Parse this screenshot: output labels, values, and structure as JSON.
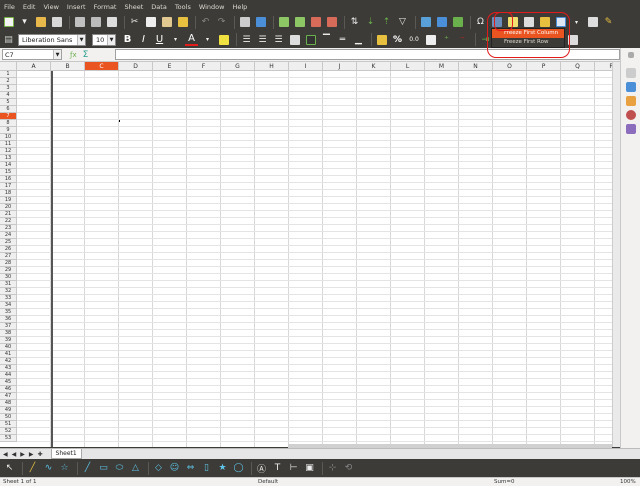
{
  "menu": [
    "File",
    "Edit",
    "View",
    "Insert",
    "Format",
    "Sheet",
    "Data",
    "Tools",
    "Window",
    "Help"
  ],
  "toolbar": {
    "font_name": "Liberation Sans",
    "font_size": "10",
    "bold_label": "B",
    "italic_label": "I",
    "underline_label": "U",
    "font_color_label": "A",
    "percent_label": "%",
    "number_label": "0.0"
  },
  "formula_bar": {
    "cell_ref": "C7",
    "sum_label": "Σ"
  },
  "columns": [
    "A",
    "B",
    "C",
    "D",
    "E",
    "F",
    "G",
    "H",
    "I",
    "J",
    "K",
    "L",
    "M",
    "N",
    "O",
    "P",
    "Q",
    "R"
  ],
  "active_column": "C",
  "row_count": 53,
  "active_row": 7,
  "freeze_menu": {
    "items": [
      "Freeze First Column",
      "Freeze First Row"
    ],
    "highlighted_index": 0
  },
  "sheet_tabs": [
    "Sheet1"
  ],
  "status": {
    "sheet_info": "Sheet 1 of 1",
    "page_style": "Default",
    "sum": "Sum=0",
    "zoom": "100%"
  },
  "colors": {
    "accent": "#e95420",
    "toolbar_bg": "#3c3b37",
    "callout": "#e21b1b"
  }
}
